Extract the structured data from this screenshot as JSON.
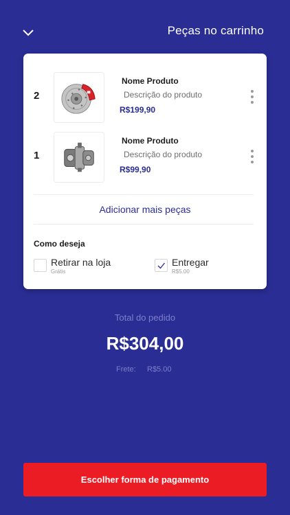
{
  "header": {
    "title": "Peças no carrinho",
    "back_icon": "chevron-down-icon"
  },
  "cart": {
    "items": [
      {
        "qty": "2",
        "name": "Nome Produto",
        "description": "Descrição do produto",
        "price": "R$199,90",
        "image": "brake-disc-caliper-image"
      },
      {
        "qty": "1",
        "name": "Nome Produto",
        "description": "Descrição do produto",
        "price": "R$99,90",
        "image": "brake-caliper-image"
      }
    ],
    "add_more_label": "Adicionar mais peças",
    "delivery": {
      "heading": "Como deseja",
      "options": [
        {
          "label": "Retirar na loja",
          "sub": "Grátis",
          "checked": false
        },
        {
          "label": "Entregar",
          "sub": "R$5.00",
          "checked": true
        }
      ]
    }
  },
  "summary": {
    "total_label": "Total do pedido",
    "total_value": "R$304,00",
    "frete_label": "Frete:",
    "frete_value": "R$5.00"
  },
  "footer": {
    "pay_button": "Escolher forma de pagamento"
  },
  "colors": {
    "background": "#2a2d94",
    "accent": "#ec1c24",
    "price": "#2a2d94"
  }
}
